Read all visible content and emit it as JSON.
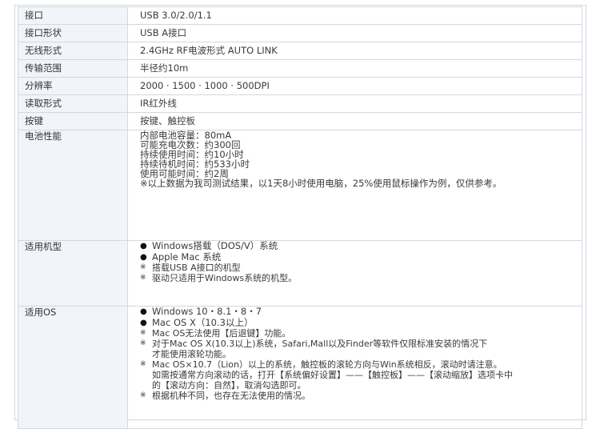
{
  "rows": [
    {
      "key": "接口",
      "value": "USB 3.0/2.0/1.1"
    },
    {
      "key": "接口形状",
      "value": "USB A接口"
    },
    {
      "key": "无线形式",
      "value": "2.4GHz RF电波形式 AUTO LINK"
    },
    {
      "key": "传输范围",
      "value": "半径约10m"
    },
    {
      "key": "分辨率",
      "value": "2000 · 1500 · 1000 · 500DPI"
    },
    {
      "key": "读取形式",
      "value": "IR红外线"
    },
    {
      "key": "按键",
      "value": "按键、触控板"
    }
  ],
  "battery": {
    "key": "电池性能",
    "lines": [
      "内部电池容量：80mA",
      "可能充电次数：约300回",
      "持续使用时间：约10小时",
      "持续待机时间：约533小时",
      "使用可能时间：约2周",
      "※以上数据为我司测试结果，以1天8小时使用电脑，25%使用鼠标操作为例，仅供参考。"
    ]
  },
  "models": {
    "key": "适用机型",
    "items": [
      {
        "mark": "●",
        "text": "Windows搭载（DOS/V）系统"
      },
      {
        "mark": "●",
        "text": "Apple Mac 系统"
      },
      {
        "mark": "※",
        "text": "搭载USB A接口的机型"
      },
      {
        "mark": "※",
        "text": "驱动只适用于Windows系统的机型。"
      }
    ]
  },
  "os": {
    "key": "适用OS",
    "items": [
      {
        "mark": "●",
        "text": "Windows 10・8.1・8・7"
      },
      {
        "mark": "●",
        "text": "Mac OS X（10.3以上）"
      },
      {
        "mark": "※",
        "text": "Mac OS无法使用【后退键】功能。"
      },
      {
        "mark": "※",
        "text": "对于Mac OS X(10.3以上)系统，Safari,Mall以及Finder等软件仅限标准安装的情况下"
      },
      {
        "mark": "",
        "text": "才能使用滚轮功能。"
      },
      {
        "mark": "※",
        "text": "Mac OS×10.7（Lion）以上的系统，触控板的滚轮方向与Win系统相反，滚动时请注意。"
      },
      {
        "mark": "",
        "text": "如需按通常方向滚动的话，打开【系统偏好设置】——【触控板】——【滚动缩放】选项卡中"
      },
      {
        "mark": "",
        "text": "的【滚动方向：自然】，取消勾选即可。"
      },
      {
        "mark": "※",
        "text": "根据机种不同，也存在无法使用的情况。"
      }
    ]
  }
}
